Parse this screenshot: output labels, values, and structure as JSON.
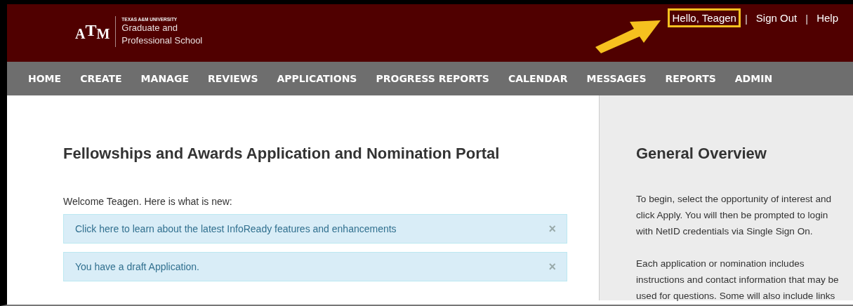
{
  "header": {
    "university": "TEXAS A&M UNIVERSITY",
    "school_line_1": "Graduate and",
    "school_line_2": "Professional School",
    "logo": "ATM",
    "user_links": [
      {
        "label": "Hello, Teagen",
        "highlighted": true
      },
      {
        "label": "Sign Out",
        "highlighted": false
      },
      {
        "label": "Help",
        "highlighted": false
      }
    ],
    "separator": "|"
  },
  "nav": [
    "HOME",
    "CREATE",
    "MANAGE",
    "REVIEWS",
    "APPLICATIONS",
    "PROGRESS REPORTS",
    "CALENDAR",
    "MESSAGES",
    "REPORTS",
    "ADMIN"
  ],
  "main": {
    "title": "Fellowships and Awards Application and Nomination Portal",
    "welcome": "Welcome Teagen. Here is what is new:",
    "alerts": [
      {
        "text": "Click here to learn about the latest InfoReady features and enhancements",
        "close": "×"
      },
      {
        "text": "You have a draft Application.",
        "close": "×"
      }
    ]
  },
  "sidebar": {
    "title": "General Overview",
    "paragraphs": [
      [
        "To begin, select the opportunity of interest and",
        "click Apply. You will then be prompted to login",
        "with NetID credentials via Single Sign On."
      ],
      [
        "Each application or nomination includes",
        "instructions and contact information that may be",
        "used for questions. Some will also include links"
      ]
    ]
  }
}
